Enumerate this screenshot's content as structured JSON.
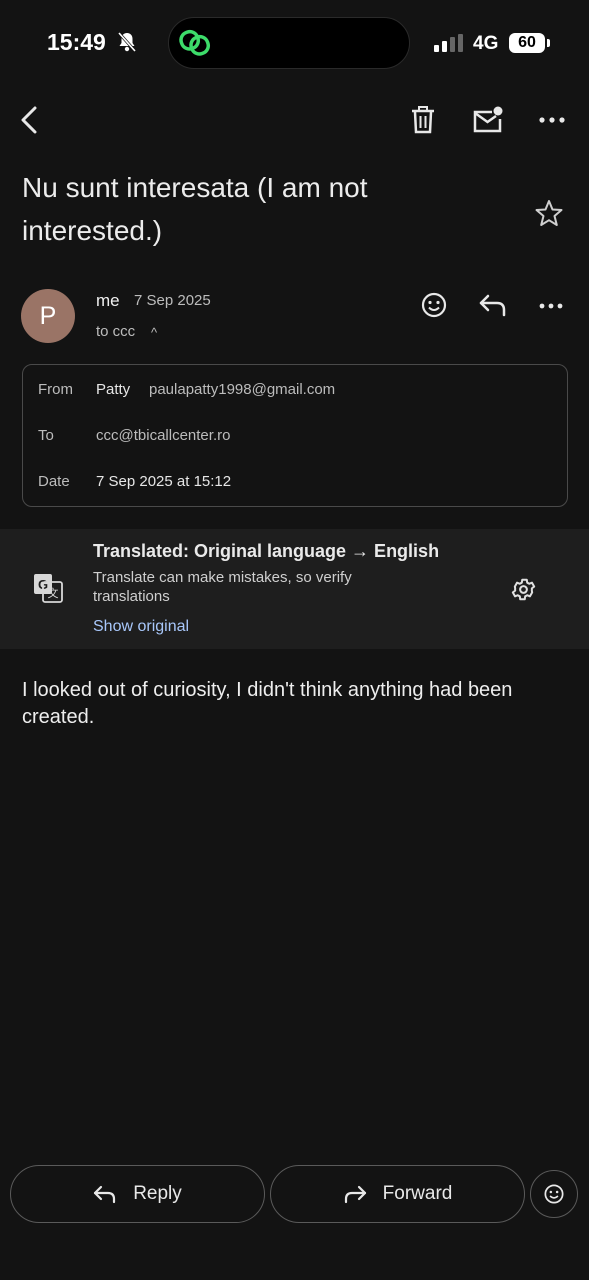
{
  "status_bar": {
    "time": "15:49",
    "network": "4G",
    "battery": "60"
  },
  "subject": "Nu sunt interesata (I am not interested.)",
  "sender": {
    "avatar_letter": "P",
    "name": "me",
    "date": "7 Sep 2025",
    "to_label": "to ccc"
  },
  "details": {
    "from_label": "From",
    "from_name": "Patty",
    "from_email": "paulapatty1998@gmail.com",
    "to_label": "To",
    "to_value": "ccc@tbicallcenter.ro",
    "date_label": "Date",
    "date_value": "7 Sep 2025 at 15:12"
  },
  "translation": {
    "title": "Translated: Original language → English",
    "note": "Translate can make mistakes, so verify translations",
    "show_original": "Show original"
  },
  "body": "I looked out of curiosity, I didn't think anything had been created.",
  "actions": {
    "reply": "Reply",
    "forward": "Forward"
  },
  "colors": {
    "background": "#131313",
    "link": "#a8c7fa",
    "avatar": "#9a7466",
    "banner": "#1e1e1e"
  }
}
